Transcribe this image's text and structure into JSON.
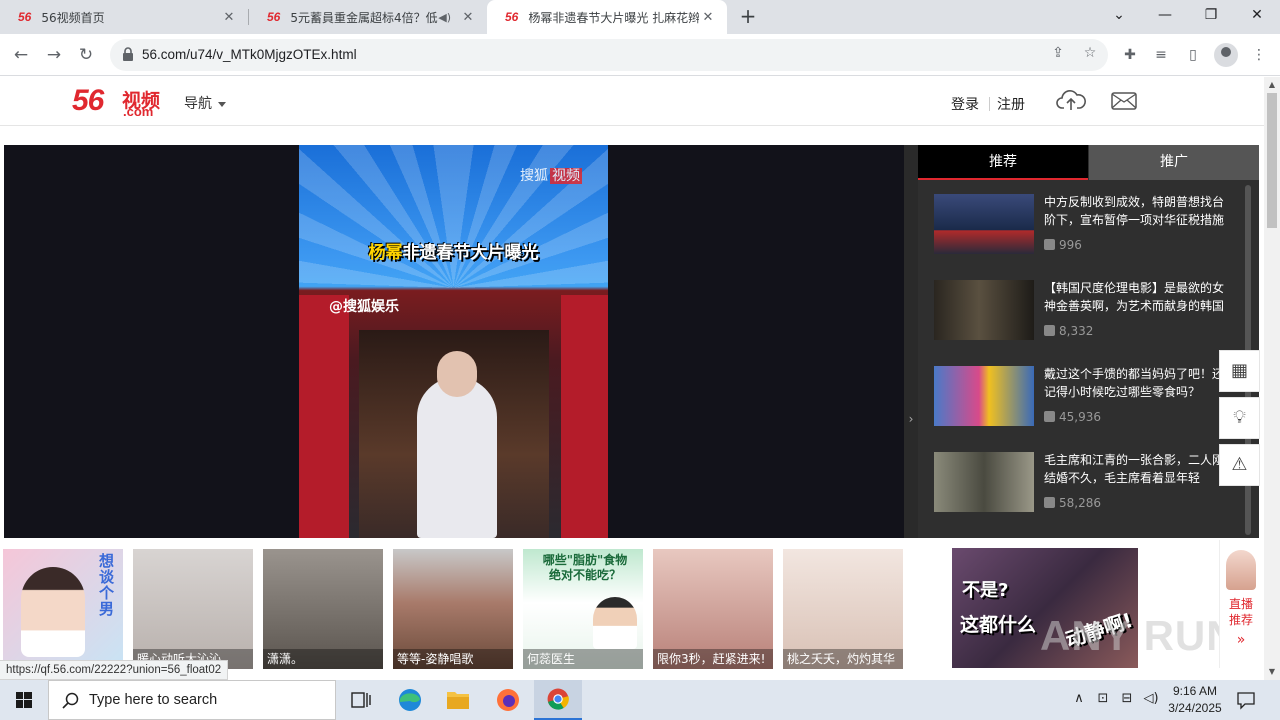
{
  "browser": {
    "tabs": [
      {
        "favicon": "56",
        "title": "56视频首页",
        "active": false
      },
      {
        "favicon": "56",
        "title": "5元蓄員重金属超标4倍？低",
        "active": false,
        "audio": true
      },
      {
        "favicon": "56",
        "title": "杨幂非遗春节大片曝光 扎麻花辫",
        "active": true
      }
    ],
    "new_tab": "+",
    "url": "56.com/u74/v_MTk0MjgzOTEx.html",
    "status_url": "https://qf.56.com/22222?union=56_float02"
  },
  "site": {
    "logo_num": "56",
    "logo_text": "视频",
    "logo_dom": ".com",
    "nav_label": "导航",
    "login": "登录",
    "register": "注册"
  },
  "video": {
    "brand": "搜狐",
    "brand_tag": "视频",
    "title_a": "杨幂",
    "title_b": "非遗春节大片曝光",
    "sub": "@搜狐娱乐"
  },
  "panel": {
    "tabs": [
      "推荐",
      "推广"
    ],
    "items": [
      {
        "title": "中方反制收到成效，特朗普想找台阶下，宣布暂停一项对华征税措施",
        "views": "996",
        "thumb": "#2a3a6a"
      },
      {
        "title": "【韩国尺度伦理电影】是最欲的女神金善英啊，为艺术而献身的韩国",
        "views": "8,332",
        "thumb": "#3a3428"
      },
      {
        "title": "戴过这个手馈的都当妈妈了吧！还记得小时候吃过哪些零食吗？",
        "views": "45,936",
        "thumb": "#4a6aa8"
      },
      {
        "title": "毛主席和江青的一张合影，二人刚结婚不久，毛主席看着显年轻",
        "views": "58,286",
        "thumb": "#6a6a5a"
      }
    ]
  },
  "ads": {
    "cards": [
      {
        "caption": "",
        "color": "#f2b8cf",
        "side_text": "想谈个男"
      },
      {
        "caption": "暖心动听大沁沁",
        "color": "#cfcac8"
      },
      {
        "caption": "潇潇。",
        "color": "#8a8480"
      },
      {
        "caption": "等等-姿静唱歌",
        "color": "#9a7a6a"
      },
      {
        "caption": "何蕊医生",
        "color": "#7fc8a0",
        "headline": "哪些\"脂肪\"食物绝对不能吃？"
      },
      {
        "caption": "限你3秒，赶紧进来!",
        "color": "#d8b0a8"
      },
      {
        "caption": "桃之夭夭，灼灼其华",
        "color": "#e8d8d0"
      }
    ],
    "big_ad": {
      "line1": "不是?",
      "line2": "这都什么",
      "line3": "动静啊!"
    },
    "live_text": "直播推荐",
    "watermark": "ANY RUN"
  },
  "taskbar": {
    "search_placeholder": "Type here to search",
    "time": "9:16 AM",
    "date": "3/24/2025"
  }
}
